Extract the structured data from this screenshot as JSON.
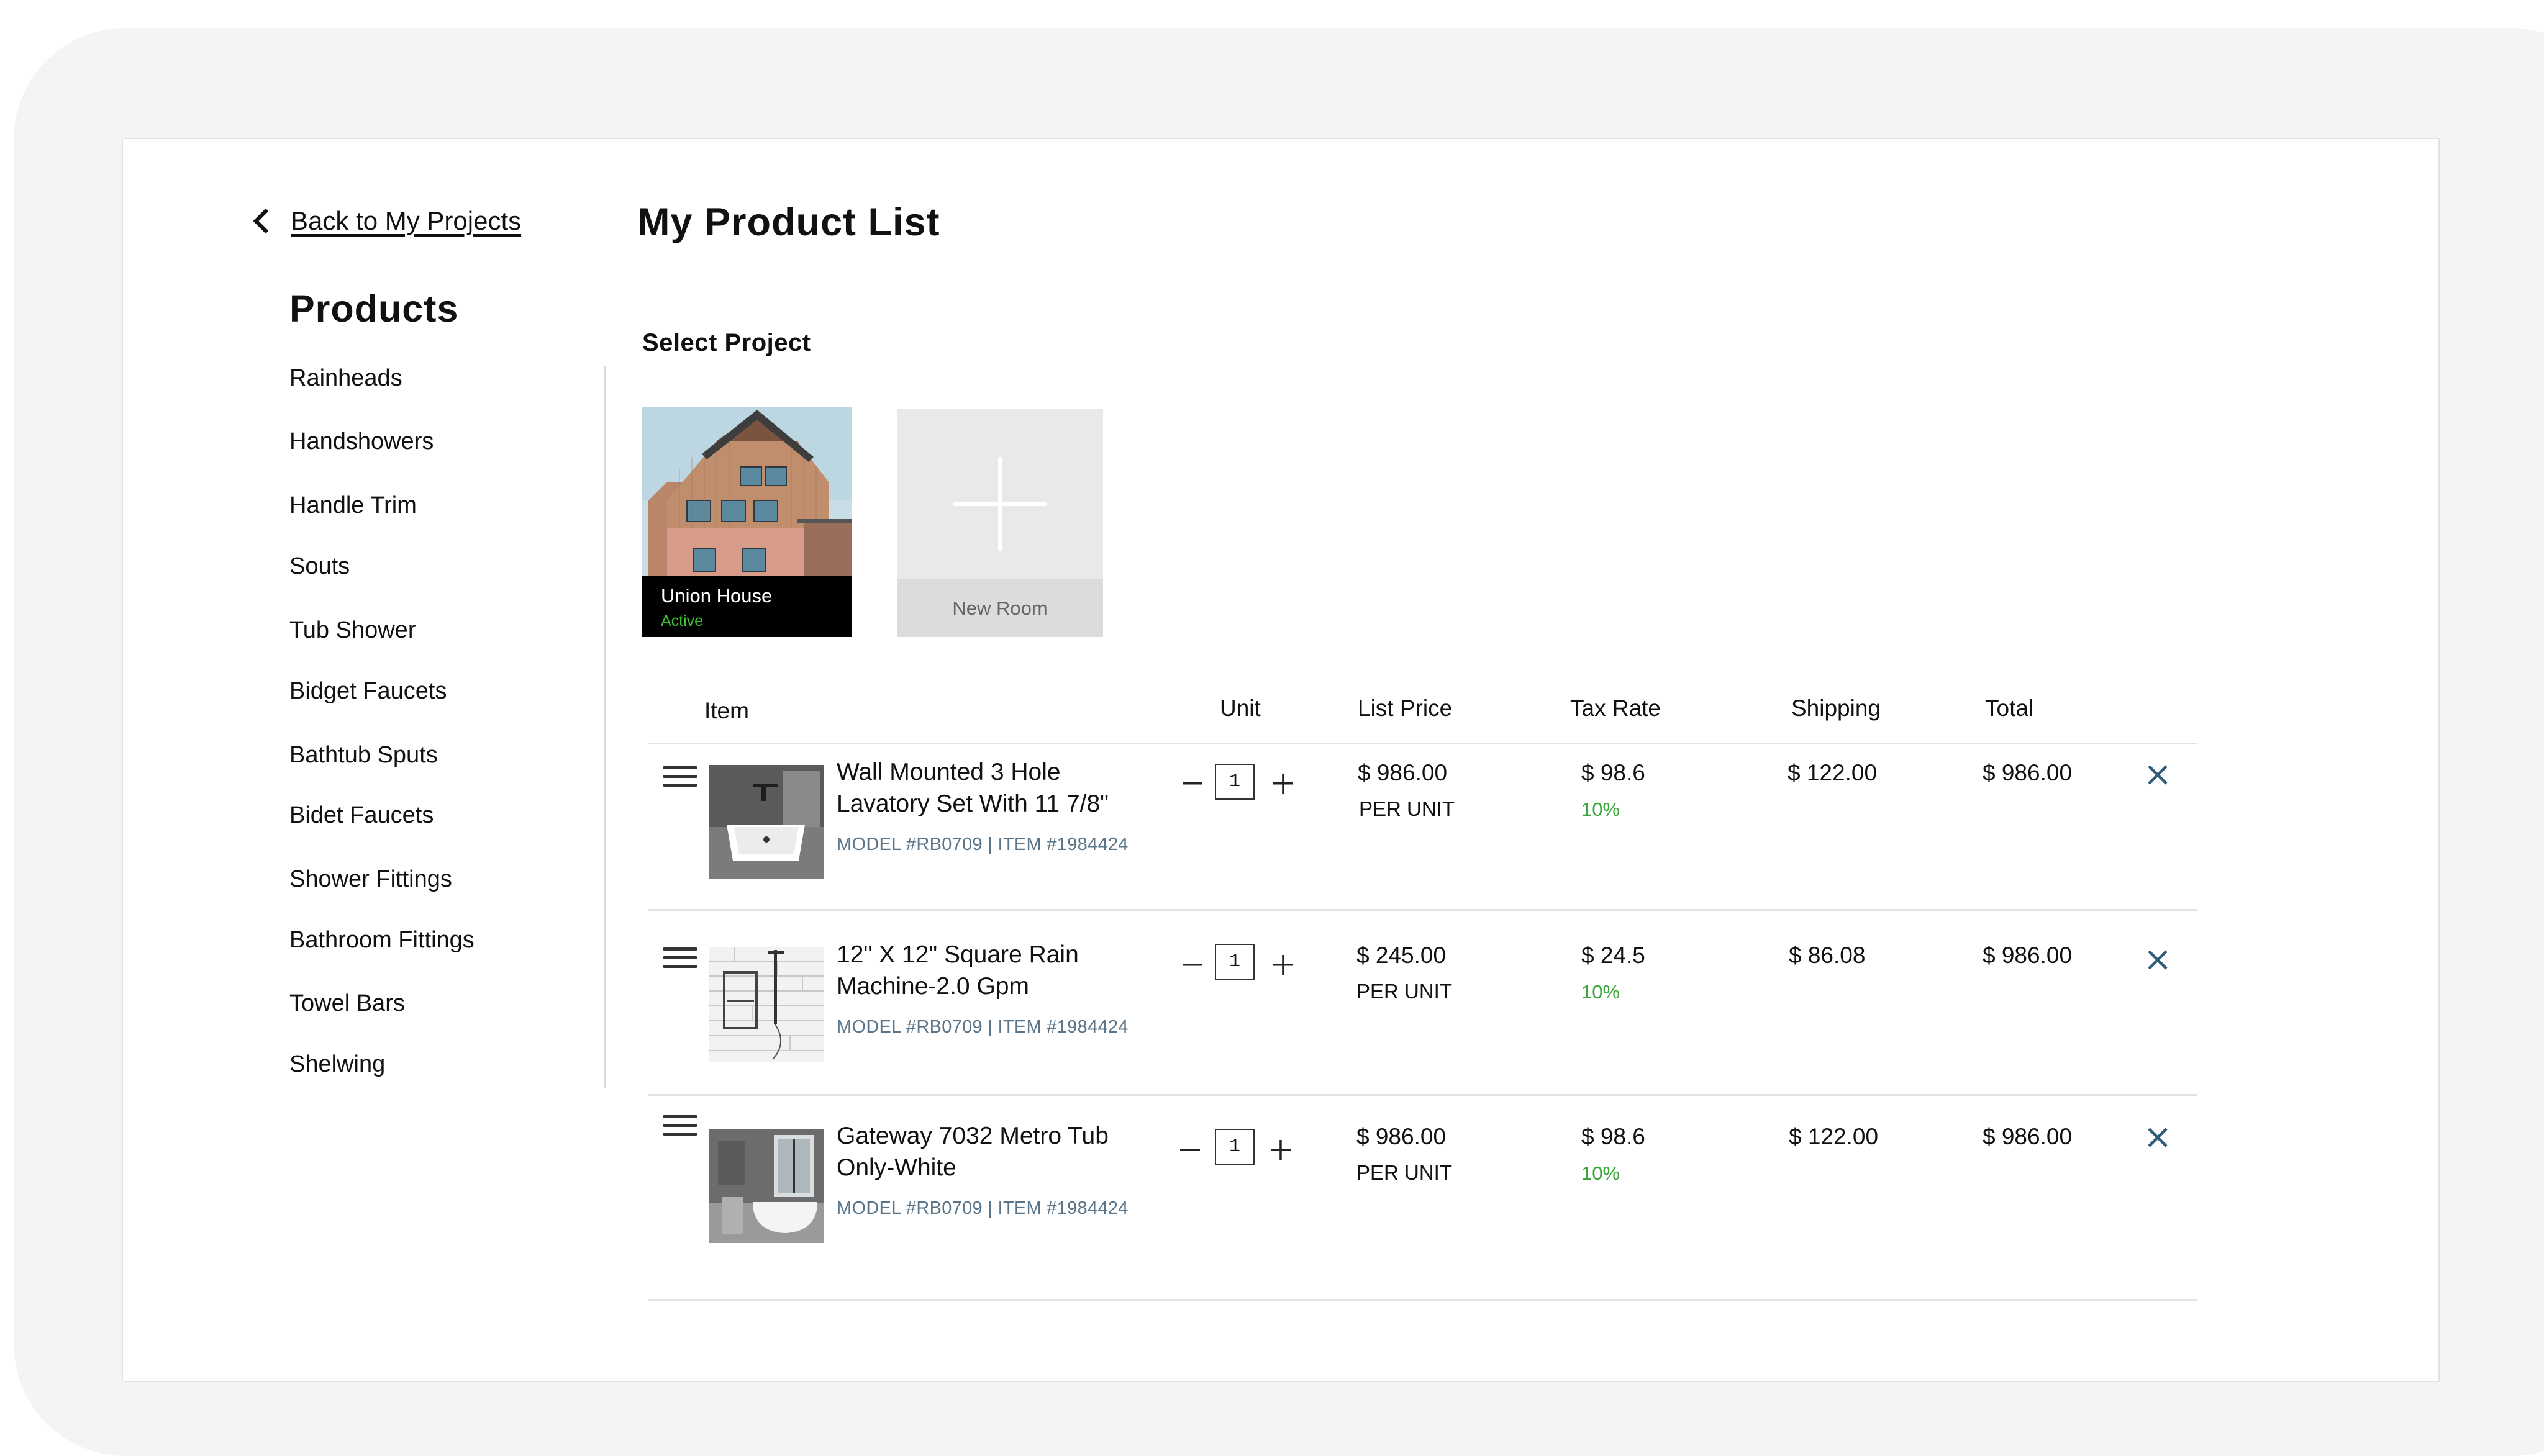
{
  "nav": {
    "back_label": "Back to My Projects"
  },
  "sidebar": {
    "title": "Products",
    "categories": [
      "Rainheads",
      "Handshowers",
      "Handle Trim",
      "Souts",
      "Tub Shower",
      "Bidget Faucets",
      "Bathtub Sputs",
      "Bidet Faucets",
      "Shower Fittings",
      "Bathroom Fittings",
      "Towel Bars",
      "Shelwing"
    ]
  },
  "page": {
    "title": "My Product List",
    "select_project_label": "Select Project"
  },
  "projects": [
    {
      "name": "Union House",
      "status": "Active"
    }
  ],
  "new_room_label": "New Room",
  "table": {
    "headers": {
      "item": "Item",
      "unit": "Unit",
      "list_price": "List Price",
      "tax_rate": "Tax Rate",
      "shipping": "Shipping",
      "total": "Total"
    },
    "rows": [
      {
        "name": "Wall Mounted 3 Hole Lavatory Set With 11 7/8\"",
        "model": "MODEL #RB0709 | ITEM #1984424",
        "qty": "1",
        "price": "$ 986.00",
        "per_unit": "PER UNIT",
        "tax": "$ 98.6",
        "tax_rate": "10%",
        "shipping": "$ 122.00",
        "total": "$ 986.00"
      },
      {
        "name": "12\" X 12\" Square Rain Machine-2.0 Gpm",
        "model": "MODEL #RB0709 | ITEM #1984424",
        "qty": "1",
        "price": "$ 245.00",
        "per_unit": "PER UNIT",
        "tax": "$ 24.5",
        "tax_rate": "10%",
        "shipping": "$ 86.08",
        "total": "$ 986.00"
      },
      {
        "name": "Gateway 7032 Metro Tub Only-White",
        "model": "MODEL #RB0709 | ITEM #1984424",
        "qty": "1",
        "price": "$ 986.00",
        "per_unit": "PER UNIT",
        "tax": "$ 98.6",
        "tax_rate": "10%",
        "shipping": "$ 122.00",
        "total": "$ 986.00"
      }
    ]
  },
  "colors": {
    "active_status": "#3fc43a",
    "tax_rate": "#3aa63a",
    "model_text": "#5a7589",
    "remove_icon": "#2f5b7a"
  }
}
